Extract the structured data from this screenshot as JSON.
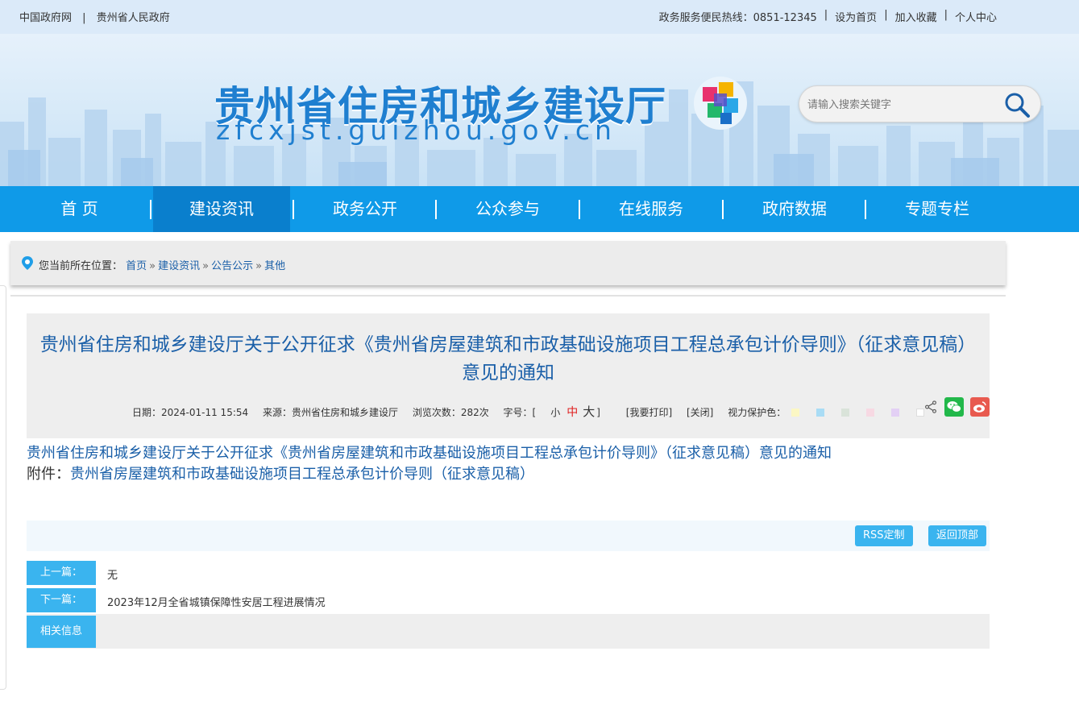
{
  "topbar": {
    "left_links": [
      "中国政府网",
      "贵州省人民政府"
    ],
    "hotline": "政务服务便民热线：0851-12345",
    "set_home": "设为首页",
    "add_fav": "加入收藏",
    "user_center": "个人中心",
    "sep": "|"
  },
  "header": {
    "title": "贵州省住房和城乡建设厅",
    "url": "zfcxjst.guizhou.gov.cn",
    "search_placeholder": "请输入搜索关键字"
  },
  "nav": {
    "items": [
      "首 页",
      "建设资讯",
      "政务公开",
      "公众参与",
      "在线服务",
      "政府数据",
      "专题专栏"
    ],
    "active_index": 1
  },
  "breadcrumb": {
    "prefix": "您当前所在位置：",
    "items": [
      "首页",
      "建设资讯",
      "公告公示",
      "其他"
    ],
    "arrow": "»"
  },
  "article": {
    "title": "贵州省住房和城乡建设厅关于公开征求《贵州省房屋建筑和市政基础设施项目工程总承包计价导则》（征求意见稿）意见的通知",
    "date": "日期：2024-01-11 15:54",
    "source": "来源：贵州省住房和城乡建设厅",
    "views": "浏览次数：282次",
    "font_label": "字号：[",
    "font_small": "小",
    "font_mid": "中",
    "font_big": "大",
    "font_close": "]",
    "print": "[我要打印]",
    "close": "[关闭]",
    "eye_label": "视力保护色：",
    "eye_colors": [
      "#fbf7c4",
      "#a9dcf5",
      "#d9e3d9",
      "#f7d9e3",
      "#e3d0f5",
      "#ffffff"
    ],
    "body_link": "贵州省住房和城乡建设厅关于公开征求《贵州省房屋建筑和市政基础设施项目工程总承包计价导则》（征求意见稿）意见的通知",
    "attachment_label": "附件：",
    "attachment_link": "贵州省房屋建筑和市政基础设施项目工程总承包计价导则（征求意见稿）"
  },
  "tools": {
    "rss": "RSS定制",
    "top": "返回顶部"
  },
  "pager": {
    "prev_label": "上一篇：",
    "prev_value": "无",
    "next_label": "下一篇：",
    "next_value": "2023年12月全省城镇保障性安居工程进展情况",
    "related_label": "相关信息"
  },
  "colors": {
    "nav_bg": "#0f9ae8",
    "nav_active": "#0a7fcd",
    "accent": "#3ab4ef",
    "link": "#1a5fa8"
  }
}
